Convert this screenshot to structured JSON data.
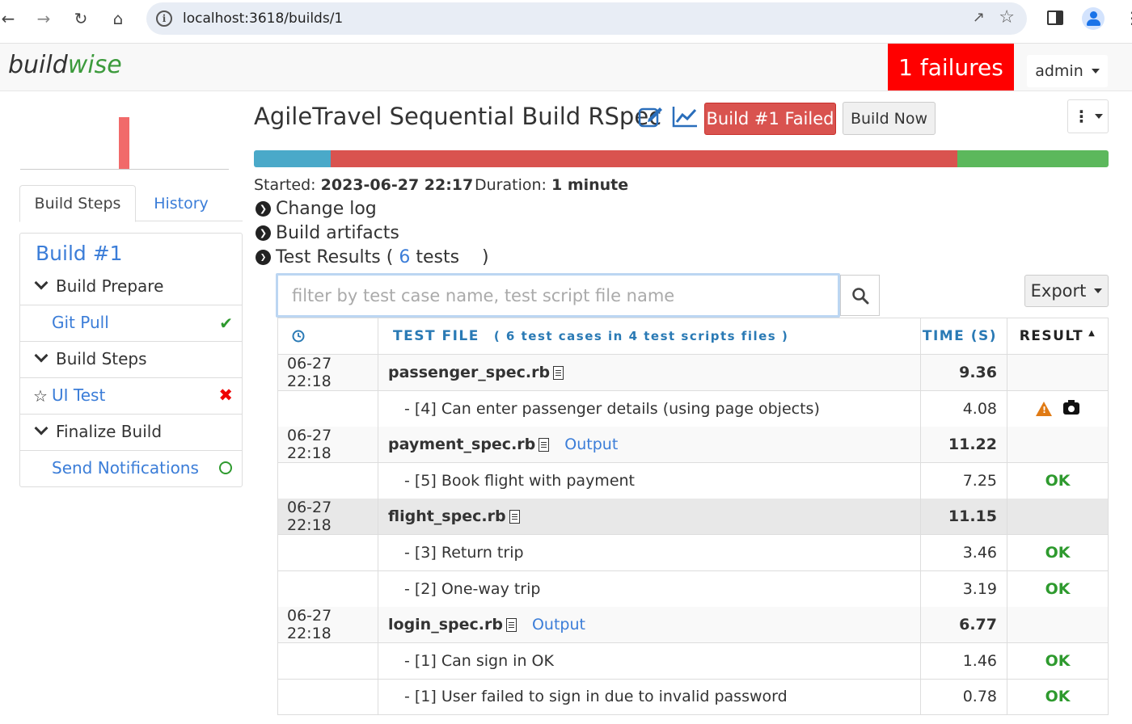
{
  "browser": {
    "url": "localhost:3618/builds/1"
  },
  "app": {
    "brand_part1": "build",
    "brand_part2": "wise",
    "failures_badge": "1 failures",
    "user_menu": "admin"
  },
  "sidebar": {
    "tabs": [
      "Build Steps",
      "History"
    ],
    "build_title": "Build #1",
    "steps": [
      {
        "type": "group",
        "label": "Build Prepare"
      },
      {
        "type": "item",
        "label": "Git Pull",
        "status": "passed"
      },
      {
        "type": "group",
        "label": "Build Steps"
      },
      {
        "type": "item",
        "label": "UI Test",
        "status": "failed",
        "starred_icon": "star-outline"
      },
      {
        "type": "group",
        "label": "Finalize Build"
      },
      {
        "type": "item",
        "label": "Send Notifications",
        "status": "pending"
      }
    ]
  },
  "main": {
    "title": "AgileTravel Sequential Build RSpec",
    "status_button": "Build #1 Failed",
    "build_now": "Build Now",
    "progress": [
      {
        "fraction": 0.09,
        "color": "#4aa9c9"
      },
      {
        "fraction": 0.733,
        "color": "#d9534f"
      },
      {
        "fraction": 0.177,
        "color": "#5cb85c"
      }
    ],
    "started_label": "Started:",
    "started_value": "2023-06-27 22:17",
    "duration_label": "Duration:",
    "duration_value": "1 minute",
    "change_log": "Change log",
    "build_artifacts": "Build artifacts",
    "test_results_prefix": "Test Results (",
    "test_count": "6",
    "test_results_suffix": " tests    )",
    "filter_placeholder": "filter by test case name, test script file name",
    "export_label": "Export"
  },
  "table": {
    "headers": {
      "file": "TEST FILE",
      "file_summary": "( 6 test cases in 4 test scripts files )",
      "time": "TIME (S)",
      "result": "RESULT"
    },
    "rows": [
      {
        "kind": "file",
        "date": "06-27 22:18",
        "name": "passenger_spec.rb",
        "output": "",
        "time": "9.36",
        "result": ""
      },
      {
        "kind": "case",
        "date": "",
        "name": "- [4] Can enter passenger details (using page objects)",
        "time": "4.08",
        "result": "warning-screenshot"
      },
      {
        "kind": "file",
        "date": "06-27 22:18",
        "name": "payment_spec.rb",
        "output": "Output",
        "time": "11.22",
        "result": ""
      },
      {
        "kind": "case",
        "date": "",
        "name": "- [5] Book flight with payment",
        "time": "7.25",
        "result": "OK"
      },
      {
        "kind": "file",
        "date": "06-27 22:18",
        "name": "flight_spec.rb",
        "output": "",
        "time": "11.15",
        "result": "",
        "highlight": true
      },
      {
        "kind": "case",
        "date": "",
        "name": "- [3] Return trip",
        "time": "3.46",
        "result": "OK"
      },
      {
        "kind": "case",
        "date": "",
        "name": "- [2] One-way trip",
        "time": "3.19",
        "result": "OK"
      },
      {
        "kind": "file",
        "date": "06-27 22:18",
        "name": "login_spec.rb",
        "output": "Output",
        "time": "6.77",
        "result": ""
      },
      {
        "kind": "case",
        "date": "",
        "name": "- [1] Can sign in OK",
        "time": "1.46",
        "result": "OK"
      },
      {
        "kind": "case",
        "date": "",
        "name": "- [1] User failed to sign in due to invalid password",
        "time": "0.78",
        "result": "OK"
      }
    ]
  }
}
